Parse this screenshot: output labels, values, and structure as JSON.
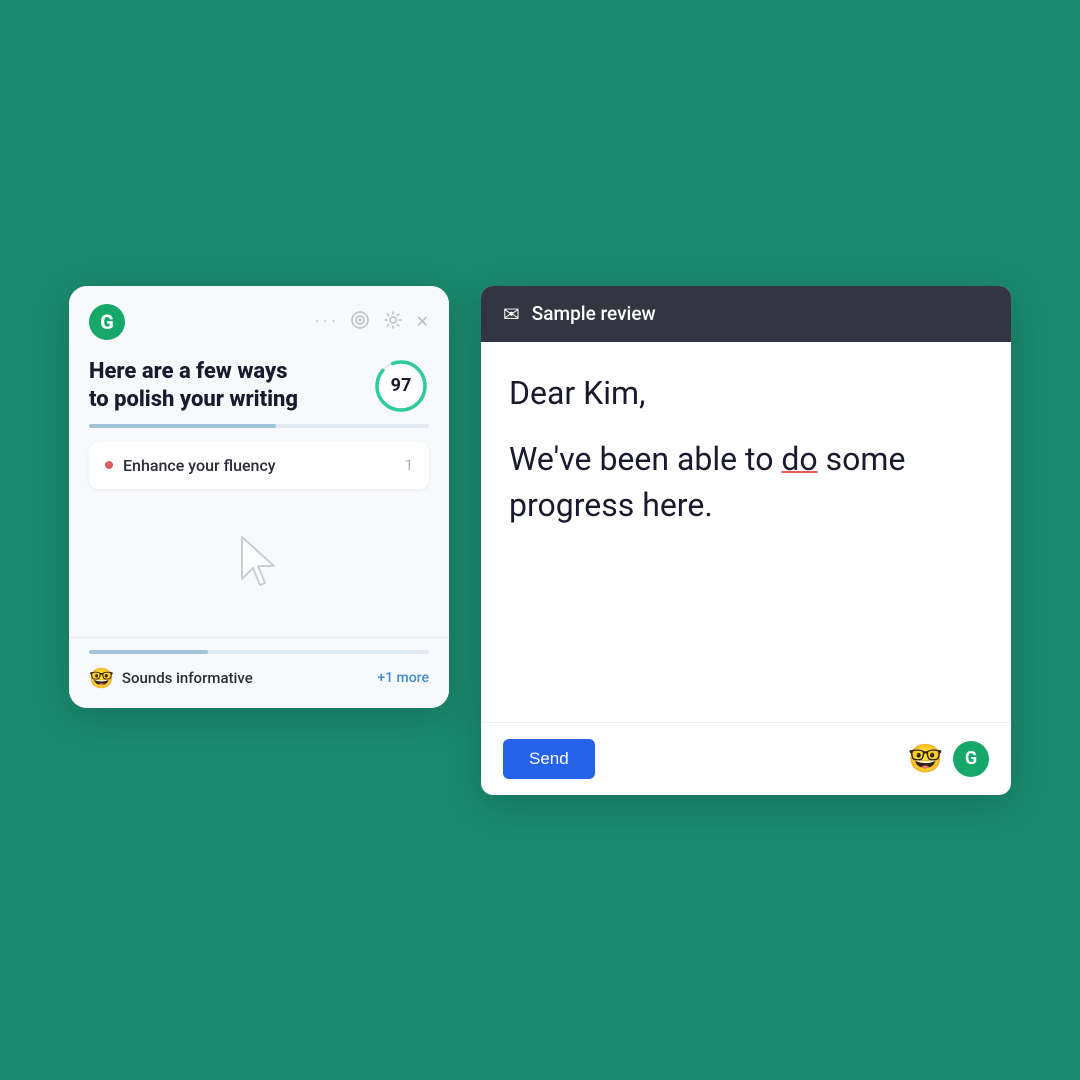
{
  "background": "#1a8a6e",
  "leftPanel": {
    "title_line1": "Here are a few ways",
    "title_line2": "to polish your writing",
    "score": "97",
    "scoreColor": "#2ecc9a",
    "icons": {
      "dots": "⋯",
      "goal": "◎",
      "settings": "⚙",
      "close": "✕"
    },
    "suggestion": {
      "label": "Enhance your fluency",
      "count": "1",
      "dotColor": "#e05c5c"
    },
    "bottomCard": {
      "emoji": "🤓",
      "label": "Sounds informative",
      "more": "+1 more"
    }
  },
  "rightPanel": {
    "header": {
      "title": "Sample review",
      "icon": "✉"
    },
    "greeting": "Dear Kim,",
    "content_part1": "We've been able to ",
    "content_highlighted": "do",
    "content_part2": " some",
    "content_line2": "progress here.",
    "sendButton": "Send"
  }
}
